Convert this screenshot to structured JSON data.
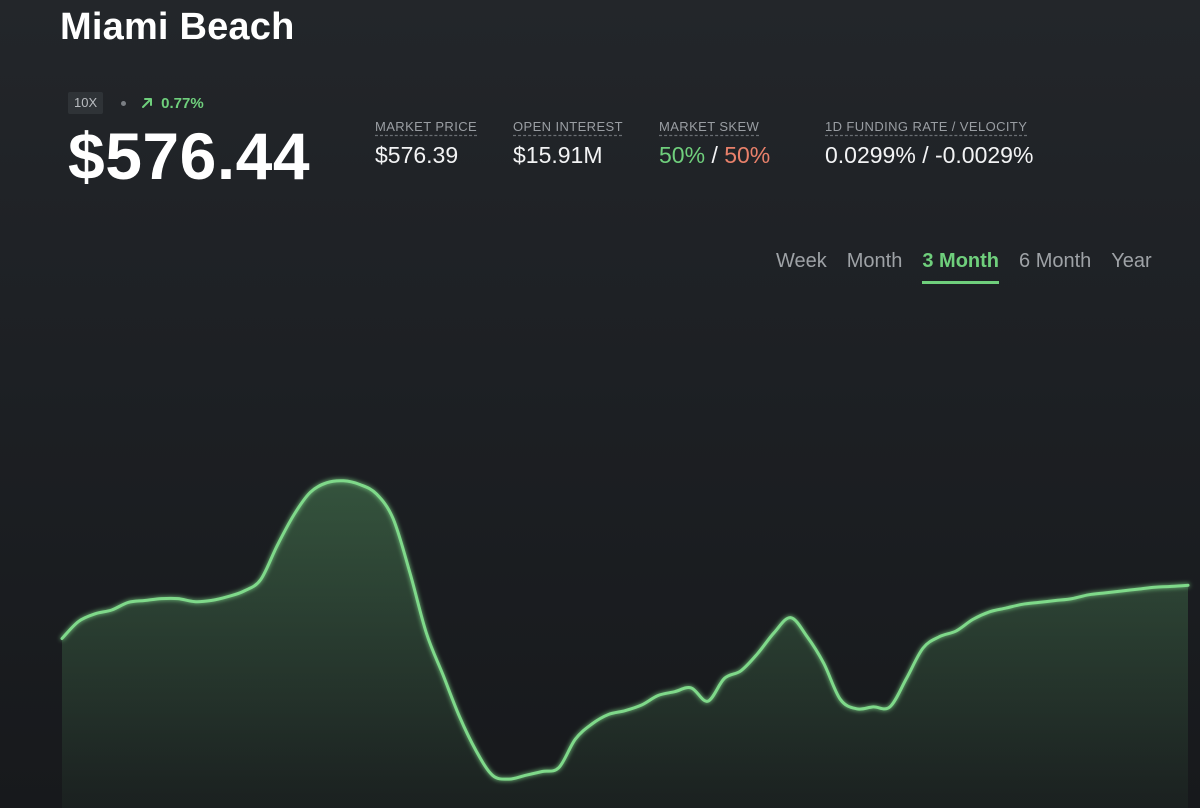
{
  "market": {
    "title": "Miami Beach",
    "leverage": "10X",
    "change": "0.77%",
    "price": "$576.44"
  },
  "stats": {
    "market_price": {
      "label": "MARKET PRICE",
      "value": "$576.39"
    },
    "open_interest": {
      "label": "OPEN INTEREST",
      "value": "$15.91M"
    },
    "market_skew": {
      "label": "MARKET SKEW",
      "long": "50%",
      "separator": "/",
      "short": "50%"
    },
    "funding": {
      "label": "1D FUNDING RATE / VELOCITY",
      "value": "0.0299% / -0.0029%"
    }
  },
  "range_tabs": {
    "week": "Week",
    "month": "Month",
    "three_month": "3 Month",
    "six_month": "6 Month",
    "year": "Year",
    "selected": "3 Month"
  },
  "colors": {
    "accent_green": "#6fcf7c",
    "accent_red": "#e8806a",
    "background": "#1d2024"
  },
  "chart_data": {
    "type": "area",
    "title": "",
    "xlabel": "",
    "ylabel": "",
    "grid": false,
    "legend": "none",
    "series": [
      {
        "values": [
          0.425,
          0.47,
          0.49,
          0.5,
          0.52,
          0.525,
          0.53,
          0.53,
          0.522,
          0.525,
          0.535,
          0.55,
          0.58,
          0.67,
          0.75,
          0.81,
          0.835,
          0.84,
          0.83,
          0.805,
          0.74,
          0.6,
          0.44,
          0.33,
          0.22,
          0.13,
          0.065,
          0.055,
          0.065,
          0.075,
          0.085,
          0.16,
          0.2,
          0.225,
          0.235,
          0.25,
          0.275,
          0.285,
          0.295,
          0.26,
          0.32,
          0.34,
          0.385,
          0.44,
          0.48,
          0.43,
          0.36,
          0.265,
          0.24,
          0.245,
          0.245,
          0.32,
          0.4,
          0.43,
          0.445,
          0.475,
          0.495,
          0.505,
          0.515,
          0.52,
          0.525,
          0.53,
          0.54,
          0.545,
          0.55,
          0.555,
          0.56,
          0.562,
          0.565
        ]
      }
    ]
  }
}
